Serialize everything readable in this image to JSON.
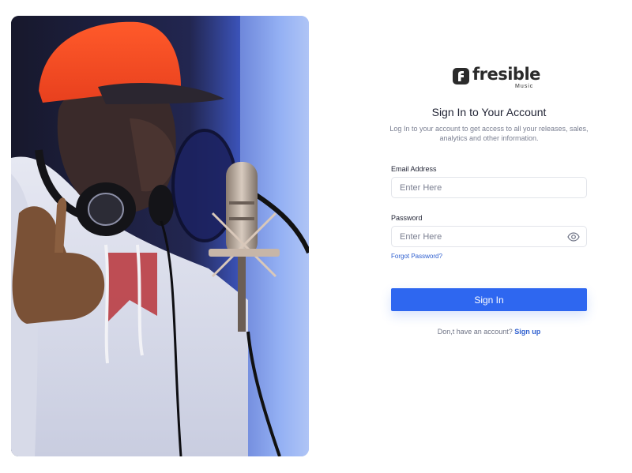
{
  "brand": {
    "name": "fresible",
    "sub": "Music",
    "accent": "#2e67f0"
  },
  "auth": {
    "title": "Sign In to Your Account",
    "subtitle": "Log In to your account to get access to all your releases, sales, analytics and other information.",
    "email": {
      "label": "Email Address",
      "placeholder": "Enter Here",
      "value": ""
    },
    "password": {
      "label": "Password",
      "placeholder": "Enter Here",
      "value": "",
      "toggle_icon": "eye-icon"
    },
    "forgot_label": "Forgot Password?",
    "submit_label": "Sign In",
    "signup_prompt": "Don,t have an account?",
    "signup_label": "Sign up"
  },
  "photo": {
    "subject": "studio-singer-with-microphone"
  }
}
